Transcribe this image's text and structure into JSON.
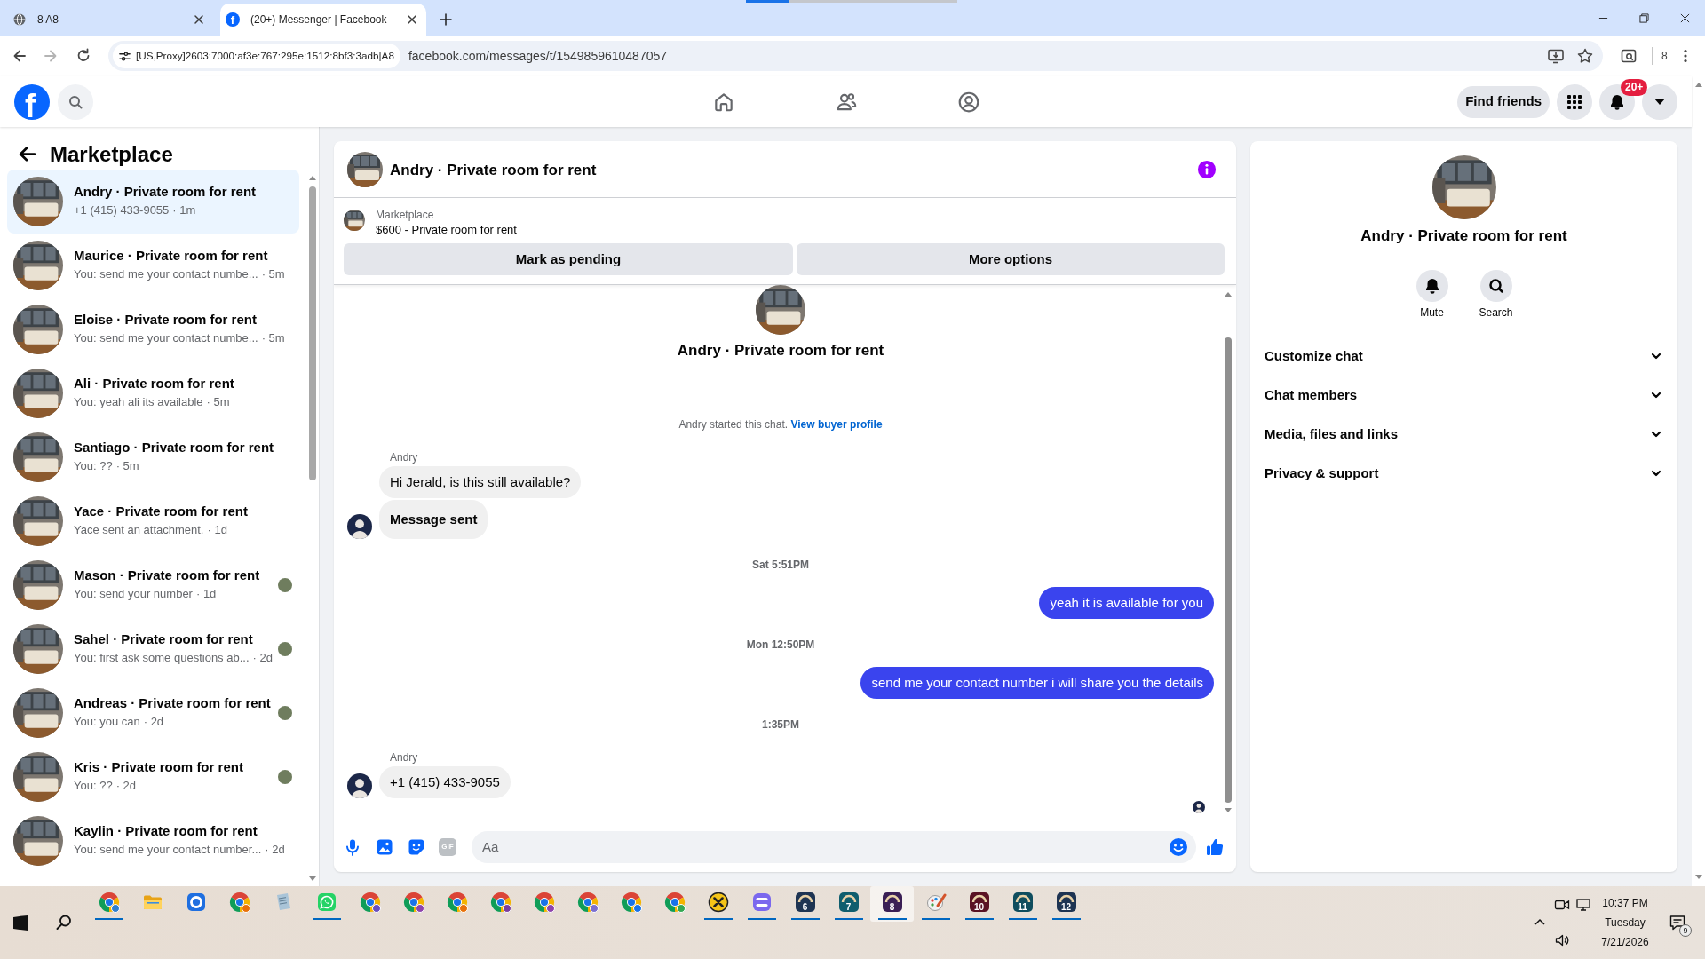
{
  "browser": {
    "tabs": [
      {
        "title": "8 A8",
        "selected": false
      },
      {
        "letter": "f",
        "title": "(20+) Messenger | Facebook",
        "selected": true
      }
    ],
    "address": {
      "chip": "[US,Proxy]2603:7000:af3e:767:295e:1512:8bf3:3adb|A8",
      "url": "facebook.com/messages/t/1549859610487057"
    },
    "profile_label": "8"
  },
  "topbar": {
    "logo": "f",
    "nav": [
      {
        "kind": "home",
        "selected": false
      },
      {
        "kind": "friends",
        "selected": false
      },
      {
        "kind": "groups",
        "selected": false
      }
    ],
    "find_friends": "Find friends",
    "notification_count": "20+"
  },
  "sidebar": {
    "title": "Marketplace",
    "conversations": [
      {
        "name": "Andry · Private room for rent",
        "snippet": "+1 (415) 433-9055",
        "time": "· 1m",
        "selected": true,
        "seen": false
      },
      {
        "name": "Maurice · Private room for rent",
        "snippet": "You: send me your contact numbe...",
        "time": "· 5m",
        "selected": false,
        "seen": false
      },
      {
        "name": "Eloise · Private room for rent",
        "snippet": "You: send me your contact numbe...",
        "time": "· 5m",
        "selected": false,
        "seen": false
      },
      {
        "name": "Ali · Private room for rent",
        "snippet": "You: yeah ali its available",
        "time": "· 5m",
        "selected": false,
        "seen": false
      },
      {
        "name": "Santiago · Private room for rent",
        "snippet": "You: ??",
        "time": "· 5m",
        "selected": false,
        "seen": false
      },
      {
        "name": "Yace · Private room for rent",
        "snippet": "Yace sent an attachment.",
        "time": "· 1d",
        "selected": false,
        "seen": false
      },
      {
        "name": "Mason · Private room for rent",
        "snippet": "You: send your number",
        "time": "· 1d",
        "selected": false,
        "seen": true
      },
      {
        "name": "Sahel · Private room for rent",
        "snippet": "You: first ask some questions ab...",
        "time": "· 2d",
        "selected": false,
        "seen": true
      },
      {
        "name": "Andreas · Private room for rent",
        "snippet": "You: you can",
        "time": "· 2d",
        "selected": false,
        "seen": true
      },
      {
        "name": "Kris · Private room for rent",
        "snippet": "You: ??",
        "time": "· 2d",
        "selected": false,
        "seen": true
      },
      {
        "name": "Kaylin · Private room for rent",
        "snippet": "You: send me your contact number...",
        "time": "· 2d",
        "selected": false,
        "seen": false
      }
    ]
  },
  "chat": {
    "title": "Andry · Private room for rent",
    "listing": {
      "label": "Marketplace",
      "title": "$600 - Private room for rent"
    },
    "actions": [
      "Mark as pending",
      "More options"
    ],
    "intro": {
      "name": "Andry · Private room for rent",
      "text": "Andry started this chat.",
      "link": "View buyer profile"
    },
    "messages": [
      {
        "kind": "sender",
        "text": "Andry"
      },
      {
        "kind": "incoming",
        "text": "Hi Jerald, is this still available?",
        "avatar": false,
        "bold": false
      },
      {
        "kind": "incoming",
        "text": "Message sent",
        "avatar": true,
        "bold": true
      },
      {
        "kind": "timestamp",
        "text": "Sat 5:51PM"
      },
      {
        "kind": "outgoing",
        "text": "yeah it is available for you"
      },
      {
        "kind": "timestamp",
        "text": "Mon 12:50PM"
      },
      {
        "kind": "outgoing",
        "text": "send me your contact number i will share you the details"
      },
      {
        "kind": "timestamp",
        "text": "1:35PM"
      },
      {
        "kind": "sender",
        "text": "Andry"
      },
      {
        "kind": "incoming",
        "text": "+1 (415) 433-9055",
        "avatar": true,
        "bold": false
      }
    ],
    "seen": true,
    "composer": {
      "gif": "GIF",
      "placeholder": "Aa"
    }
  },
  "details": {
    "title": "Andry · Private room for rent",
    "actions": [
      {
        "kind": "mute",
        "label": "Mute"
      },
      {
        "kind": "search",
        "label": "Search"
      }
    ],
    "sections": [
      {
        "label": "Customize chat",
        "expanded": false
      },
      {
        "label": "Chat members",
        "expanded": false
      },
      {
        "label": "Media, files and links",
        "expanded": false
      },
      {
        "label": "Privacy & support",
        "expanded": false
      }
    ]
  },
  "taskbar": {
    "apps": [
      {
        "kind": "chrome",
        "color": "#2f7fd0",
        "running": true,
        "selected": false
      },
      {
        "kind": "explorer",
        "running": false,
        "selected": false
      },
      {
        "kind": "ring",
        "running": false,
        "selected": false
      },
      {
        "kind": "chrome",
        "color": "#e8710a",
        "running": false,
        "selected": false
      },
      {
        "kind": "notepad",
        "running": false,
        "selected": false
      },
      {
        "kind": "whatsapp",
        "running": true,
        "selected": false
      },
      {
        "kind": "chrome",
        "color": "#6a4fc0",
        "running": false,
        "selected": false
      },
      {
        "kind": "chrome",
        "color": "#8e44ad",
        "running": false,
        "selected": false
      },
      {
        "kind": "chrome",
        "color": "#e8710a",
        "running": false,
        "selected": false
      },
      {
        "kind": "chrome",
        "color": "#7b3fa0",
        "running": false,
        "selected": false
      },
      {
        "kind": "chrome",
        "color": "#8e44ad",
        "running": false,
        "selected": false
      },
      {
        "kind": "chrome",
        "color": "#7b6fd0",
        "running": false,
        "selected": false
      },
      {
        "kind": "chrome",
        "color": "#1a73e8",
        "running": false,
        "selected": false
      },
      {
        "kind": "chrome",
        "color": "#34a853",
        "running": false,
        "selected": false
      },
      {
        "kind": "ix",
        "running": true,
        "selected": false
      },
      {
        "kind": "stripes",
        "running": true,
        "selected": false
      },
      {
        "kind": "gauge",
        "label": "6",
        "color": "#1e3452",
        "running": true,
        "selected": false
      },
      {
        "kind": "gauge",
        "label": "7",
        "color": "#0f5e6e",
        "running": true,
        "selected": false
      },
      {
        "kind": "gauge",
        "label": "8",
        "color": "#3a1f55",
        "running": true,
        "selected": true
      },
      {
        "kind": "paint",
        "running": true,
        "selected": false
      },
      {
        "kind": "gauge",
        "label": "10",
        "color": "#5a1224",
        "running": true,
        "selected": false
      },
      {
        "kind": "gauge",
        "label": "11",
        "color": "#0f4d5e",
        "running": true,
        "selected": false
      },
      {
        "kind": "gauge",
        "label": "12",
        "color": "#1e3452",
        "running": true,
        "selected": false
      }
    ],
    "clock": {
      "time": "10:37 PM",
      "day": "Tuesday",
      "date": "7/21/2026"
    },
    "notification_count": "9"
  }
}
